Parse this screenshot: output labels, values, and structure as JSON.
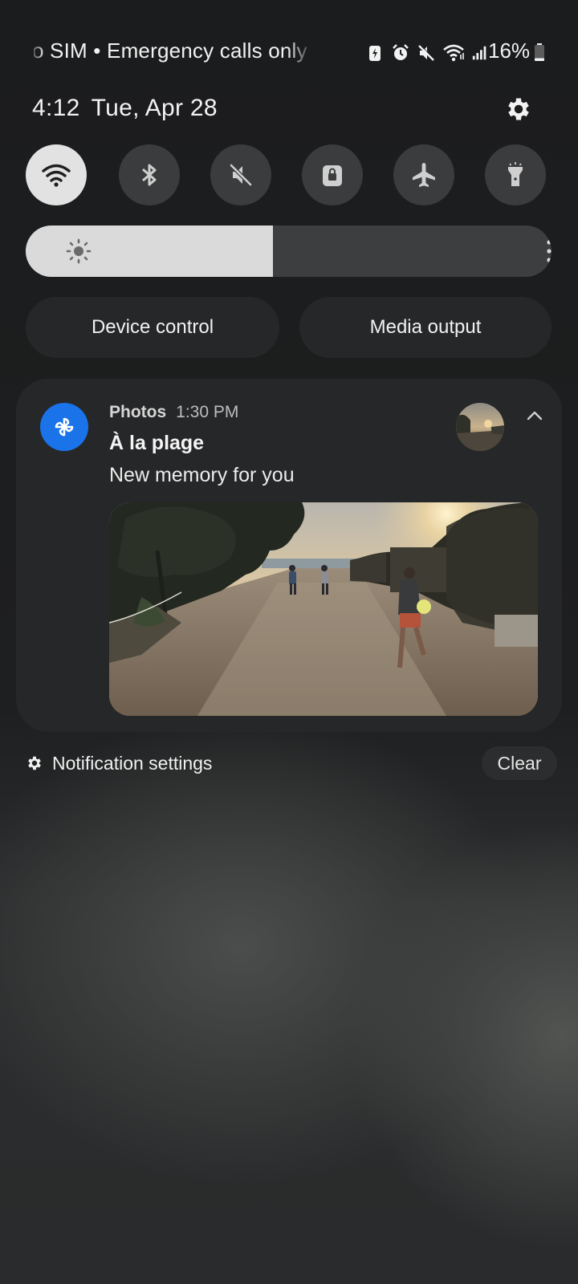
{
  "status_bar": {
    "carrier_text": "No SIM • Emergency calls only",
    "battery_percent": "16%",
    "battery_level": 0.16,
    "icons": [
      "battery-saver-icon",
      "alarm-icon",
      "mute-icon",
      "wifi-icon",
      "signal-icon",
      "battery-icon"
    ]
  },
  "header": {
    "time": "4:12",
    "date": "Tue, Apr 28",
    "settings_icon": "gear-icon"
  },
  "quick_settings": [
    {
      "name": "Wi-Fi",
      "icon": "wifi-icon",
      "active": true
    },
    {
      "name": "Bluetooth",
      "icon": "bluetooth-icon",
      "active": false
    },
    {
      "name": "Mute",
      "icon": "mute-icon",
      "active": false
    },
    {
      "name": "Screen lock",
      "icon": "lock-icon",
      "active": false
    },
    {
      "name": "Airplane mode",
      "icon": "airplane-icon",
      "active": false
    },
    {
      "name": "Flashlight",
      "icon": "flashlight-icon",
      "active": false
    }
  ],
  "brightness": {
    "level": 0.47,
    "icon": "sun-icon",
    "more_icon": "more-vertical-icon"
  },
  "controls": {
    "device_control_label": "Device control",
    "media_output_label": "Media output"
  },
  "notification": {
    "app_name": "Photos",
    "time": "1:30 PM",
    "title": "À la plage",
    "body": "New memory for you",
    "app_icon": "photos-pinwheel-icon",
    "accent_color": "#1a73e8"
  },
  "footer": {
    "settings_label": "Notification settings",
    "clear_label": "Clear"
  },
  "colors": {
    "background": "#1e1f20",
    "card": "#262728",
    "tile_inactive": "#3b3c3d",
    "tile_active": "#e1e2e1"
  }
}
